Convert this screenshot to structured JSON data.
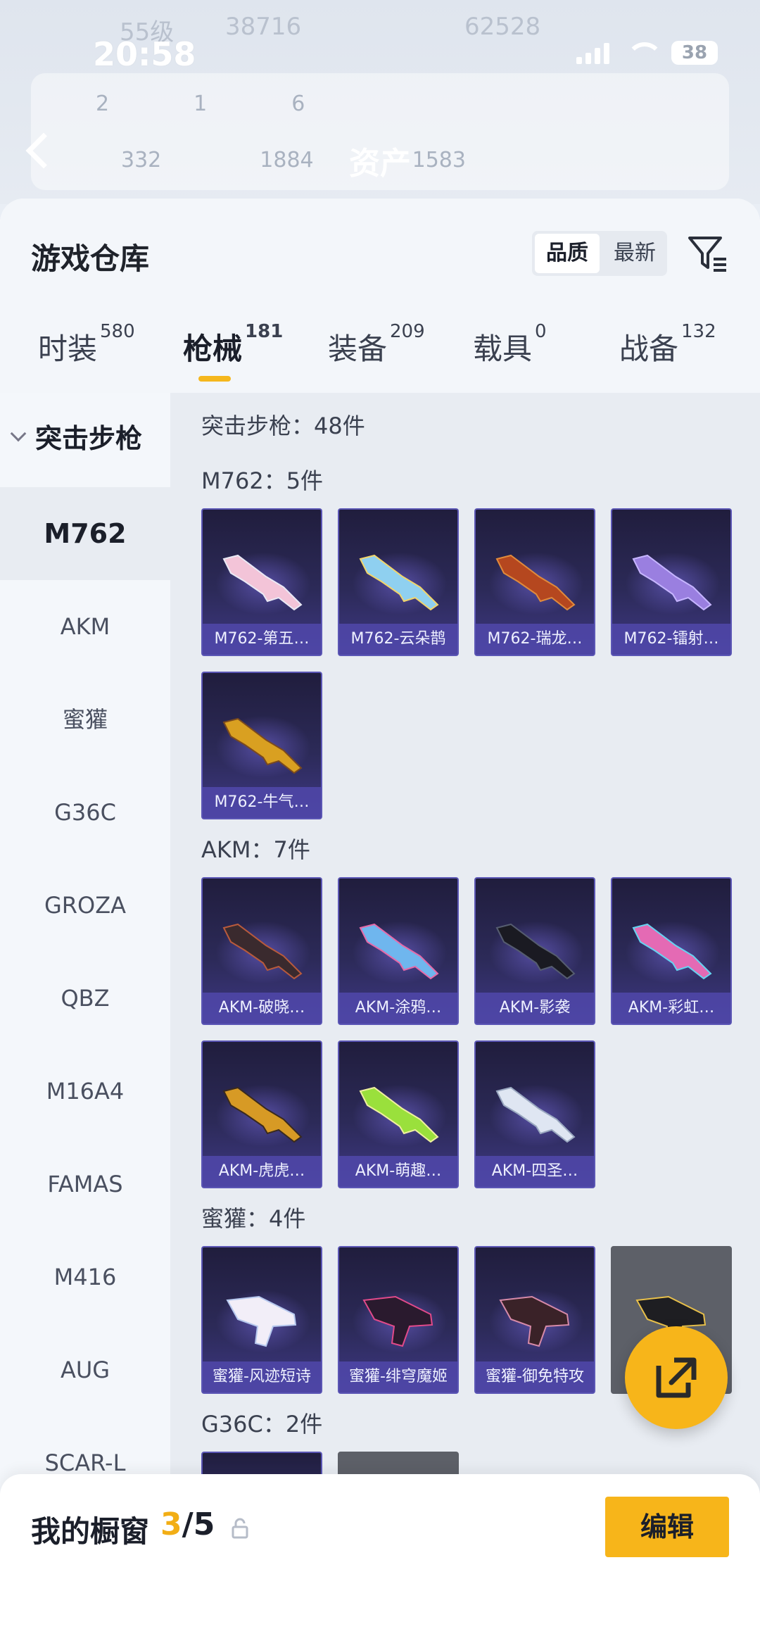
{
  "status_bar": {
    "time": "20:58",
    "battery": "38"
  },
  "header_faded": {
    "level": "55级",
    "points": "38716",
    "coins": "62528"
  },
  "asset_header": {
    "title": "资产",
    "stats_row1": [
      "2",
      "1",
      "6"
    ],
    "stats_row2": [
      "332",
      "1884",
      "1583"
    ]
  },
  "warehouse": {
    "title": "游戏仓库",
    "sort_options": [
      "品质",
      "最新"
    ],
    "sort_selected": "品质"
  },
  "tabs": [
    {
      "label": "时装",
      "count": "580"
    },
    {
      "label": "枪械",
      "count": "181",
      "active": true
    },
    {
      "label": "装备",
      "count": "209"
    },
    {
      "label": "载具",
      "count": "0"
    },
    {
      "label": "战备",
      "count": "132"
    }
  ],
  "sidebar": {
    "category": "突击步枪",
    "items": [
      "M762",
      "AKM",
      "蜜獾",
      "G36C",
      "GROZA",
      "QBZ",
      "M16A4",
      "FAMAS",
      "M416",
      "AUG",
      "SCAR-L"
    ],
    "active": "M762"
  },
  "content": {
    "category_total": "突击步枪：48件",
    "sections": [
      {
        "title": "M762：5件",
        "items": [
          "M762-第五…",
          "M762-云朵鹊",
          "M762-瑞龙…",
          "M762-镭射…",
          "M762-牛气…"
        ]
      },
      {
        "title": "AKM：7件",
        "items": [
          "AKM-破晓…",
          "AKM-涂鸦…",
          "AKM-影袭",
          "AKM-彩虹…",
          "AKM-虎虎…",
          "AKM-萌趣…",
          "AKM-四圣…"
        ]
      },
      {
        "title": "蜜獾：4件",
        "items": [
          "蜜獾-风迹短诗",
          "蜜獾-绯穹魔姬",
          "蜜獾-御免特攻",
          ""
        ]
      },
      {
        "title": "G36C：2件",
        "items": [
          "",
          ""
        ]
      }
    ]
  },
  "bottom_bar": {
    "label": "我的橱窗",
    "current": "3",
    "total": "/5",
    "edit_label": "编辑"
  },
  "colors": {
    "accent": "#f7b51a",
    "tile_dark": "#201d3d",
    "tile_border": "#5b56b5"
  }
}
